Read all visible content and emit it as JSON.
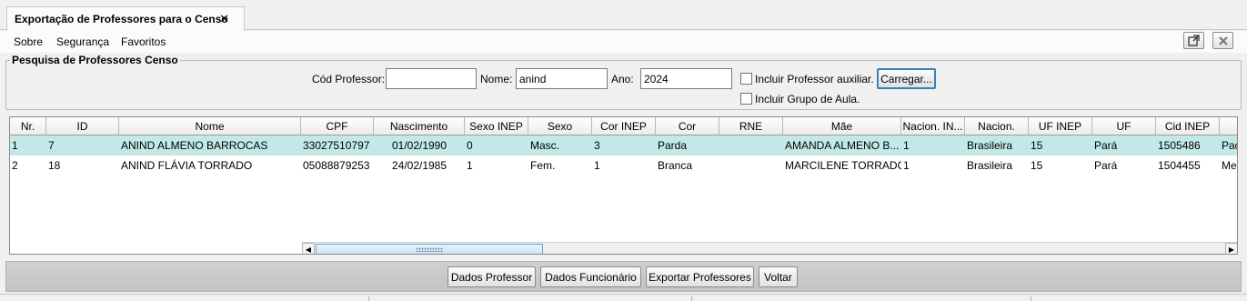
{
  "tab": {
    "title": "Exportação de Professores para o Censo",
    "close_glyph": "✕"
  },
  "menu": [
    "Sobre",
    "Segurança",
    "Favoritos"
  ],
  "window_buttons": {
    "detach_icon": "external-window-icon",
    "close_icon": "close-x-icon"
  },
  "search": {
    "title": "Pesquisa de Professores Censo",
    "cod_label": "Cód Professor:",
    "cod_value": "",
    "nome_label": "Nome:",
    "nome_value": "anind",
    "ano_label": "Ano:",
    "ano_value": "2024",
    "aux_label": "Incluir Professor auxiliar.",
    "grupo_label": "Incluir Grupo de Aula.",
    "load_button": "Carregar..."
  },
  "table": {
    "columns": [
      "Nr.",
      "ID",
      "Nome",
      "CPF",
      "Nascimento",
      "Sexo INEP",
      "Sexo",
      "Cor INEP",
      "Cor",
      "RNE",
      "Mãe",
      "Nacion. IN...",
      "Nacion.",
      "UF INEP",
      "UF",
      "Cid INEP",
      ""
    ],
    "rows": [
      [
        "1",
        "7",
        "ANIND ALMENO BARROCAS",
        "33027510797",
        "01/02/1990",
        "0",
        "Masc.",
        "3",
        "Parda",
        "",
        "AMANDA ALMENO B...",
        "1",
        "Brasileira",
        "15",
        "Pará",
        "1505486",
        "Pac"
      ],
      [
        "2",
        "18",
        "ANIND FLÁVIA TORRADO",
        "05088879253",
        "24/02/1985",
        "1",
        "Fem.",
        "1",
        "Branca",
        "",
        "MARCILENE TORRADO",
        "1",
        "Brasileira",
        "15",
        "Pará",
        "1504455",
        "Me"
      ]
    ],
    "selected_row": 0
  },
  "actions": [
    "Dados Professor",
    "Dados Funcionário",
    "Exportar Professores",
    "Voltar"
  ],
  "colors": {
    "selected_row": "#c3e8e8",
    "focus_border": "#3c7fb1",
    "bottom_panel": "#c9c9c9"
  }
}
